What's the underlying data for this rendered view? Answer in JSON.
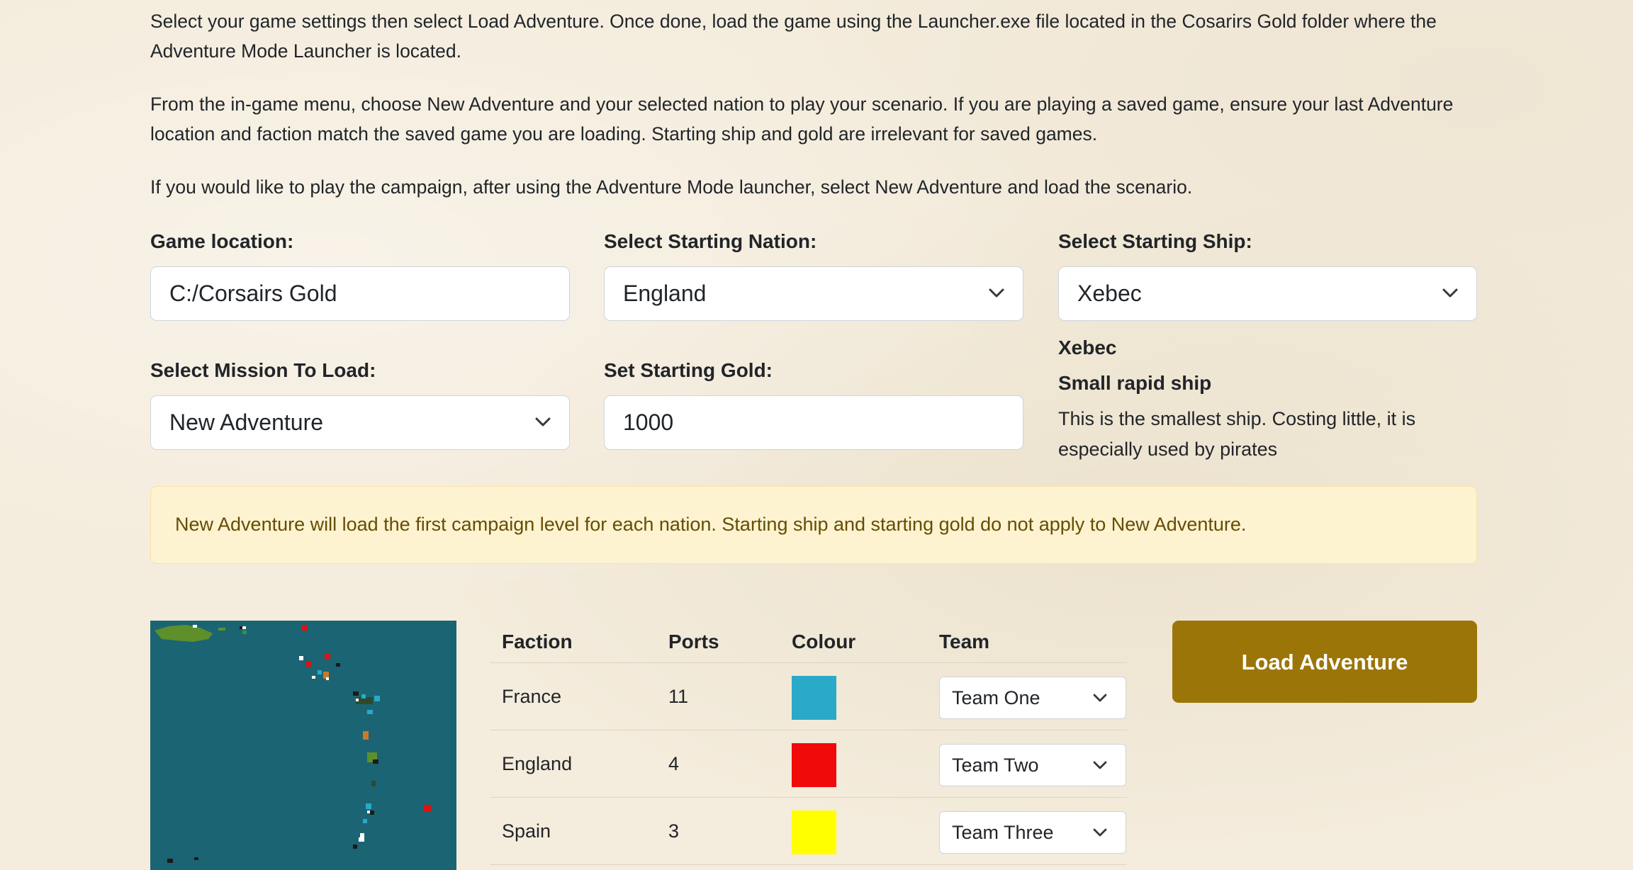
{
  "intro": {
    "p1": "Select your game settings then select Load Adventure. Once done, load the game using the Launcher.exe file located in the Cosarirs Gold folder where the Adventure Mode Launcher is located.",
    "p2": "From the in-game menu, choose New Adventure and your selected nation to play your scenario. If you are playing a saved game, ensure your last Adventure location and faction match the saved game you are loading. Starting ship and gold are irrelevant for saved games.",
    "p3": "If you would like to play the campaign, after using the Adventure Mode launcher, select New Adventure and load the scenario."
  },
  "form": {
    "game_location": {
      "label": "Game location:",
      "value": "C:/Corsairs Gold"
    },
    "nation": {
      "label": "Select Starting Nation:",
      "value": "England"
    },
    "ship": {
      "label": "Select Starting Ship:",
      "value": "Xebec"
    },
    "mission": {
      "label": "Select Mission To Load:",
      "value": "New Adventure"
    },
    "gold": {
      "label": "Set Starting Gold:",
      "value": "1000"
    }
  },
  "ship_info": {
    "name": "Xebec",
    "type": "Small rapid ship",
    "description": "This is the smallest ship. Costing little, it is especially used by pirates"
  },
  "alert": "New Adventure will load the first campaign level for each nation. Starting ship and starting gold do not apply to New Adventure.",
  "table": {
    "headers": {
      "faction": "Faction",
      "ports": "Ports",
      "colour": "Colour",
      "team": "Team"
    },
    "rows": [
      {
        "faction": "France",
        "ports": "11",
        "colour": "#2aa9c9",
        "team": "Team One"
      },
      {
        "faction": "England",
        "ports": "4",
        "colour": "#f00a0a",
        "team": "Team Two"
      },
      {
        "faction": "Spain",
        "ports": "3",
        "colour": "#ffff00",
        "team": "Team Three"
      }
    ]
  },
  "load_button": "Load Adventure",
  "map": {
    "sea_color": "#1b6474"
  },
  "icons": {
    "dropdown": "chevron-down-icon"
  }
}
